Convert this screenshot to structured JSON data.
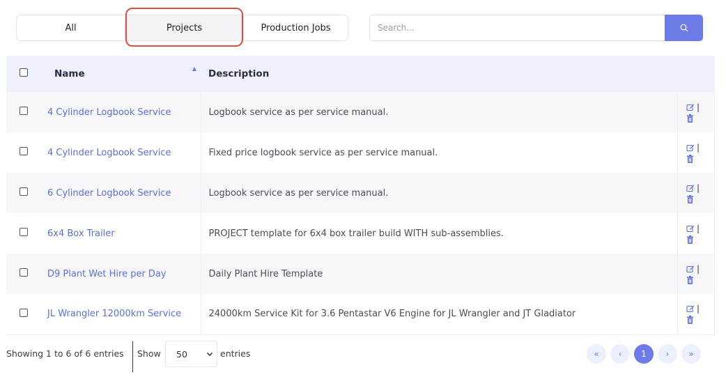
{
  "filters": {
    "all": "All",
    "projects": "Projects",
    "production_jobs": "Production Jobs"
  },
  "search": {
    "placeholder": "Search..."
  },
  "table": {
    "headers": {
      "name": "Name",
      "description": "Description"
    },
    "rows": [
      {
        "name": "4 Cylinder Logbook Service",
        "description": "Logbook service as per service manual."
      },
      {
        "name": "4 Cylinder Logbook Service",
        "description": "Fixed price logbook service as per service manual."
      },
      {
        "name": "6 Cylinder Logbook Service",
        "description": "Logbook service as per service manual."
      },
      {
        "name": "6x4 Box Trailer",
        "description": "PROJECT template for 6x4 box trailer build WITH sub-assemblies."
      },
      {
        "name": "D9 Plant Wet Hire per Day",
        "description": "Daily Plant Hire Template"
      },
      {
        "name": "JL Wrangler 12000km Service",
        "description": "24000km Service Kit for 3.6 Pentastar V6 Engine for JL Wrangler and JT Gladiator"
      }
    ],
    "action_separator": "|"
  },
  "footer": {
    "info": "Showing 1 to 6 of 6 entries",
    "show_label": "Show",
    "page_size": "50",
    "entries_label": "entries"
  },
  "pagination": {
    "first": "«",
    "prev": "‹",
    "current": "1",
    "next": "›",
    "last": "»"
  },
  "colors": {
    "accent": "#6c7be8",
    "link": "#5b6fe0",
    "highlight": "#d9503f"
  }
}
